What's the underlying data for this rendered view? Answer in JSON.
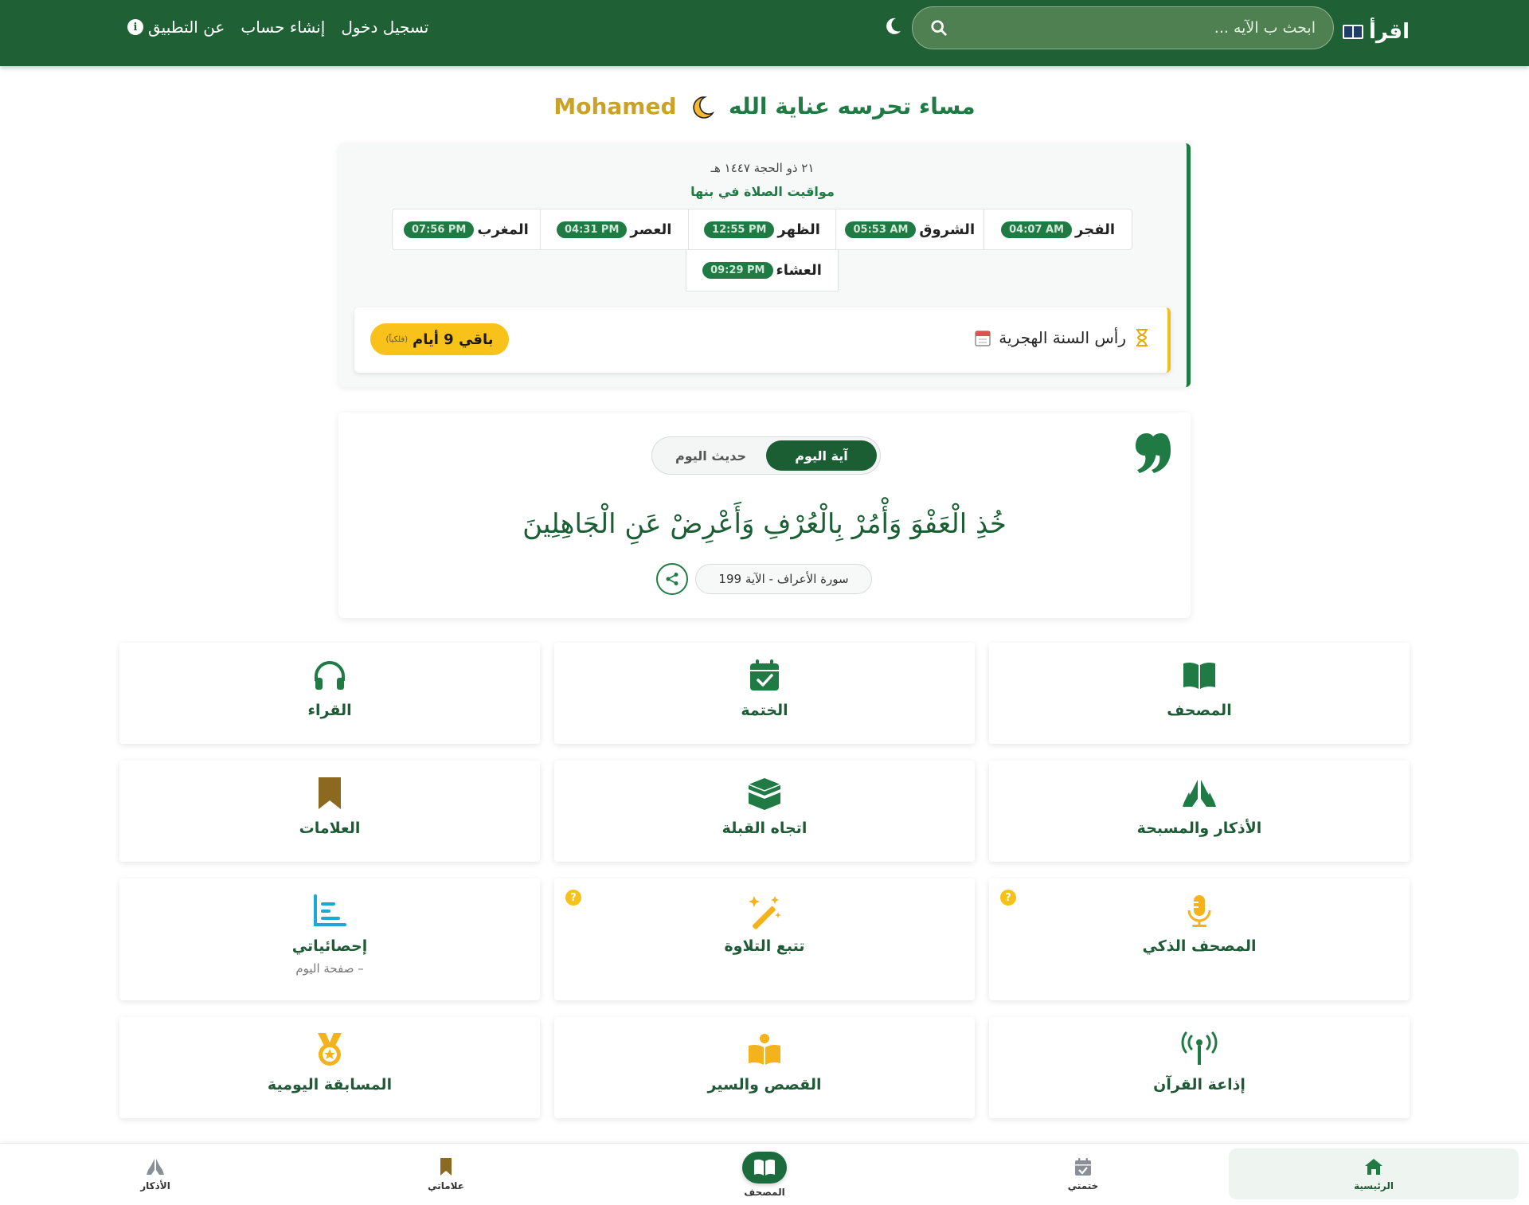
{
  "header": {
    "brand": "اقرأ",
    "search_placeholder": "ابحث ب الآيه ...",
    "nav": {
      "login": "تسجيل دخول",
      "register": "إنشاء حساب",
      "about": "عن التطبيق",
      "info_glyph": "i"
    }
  },
  "greeting": {
    "text": "مساء تحرسه عناية الله",
    "name": "Mohamed"
  },
  "prayer": {
    "hijri_date": "٢١ ذو الحجة ١٤٤٧ هـ",
    "city_label": "مواقيت الصلاة في بنها",
    "times": [
      {
        "name": "الفجر",
        "time": "04:07 AM"
      },
      {
        "name": "الشروق",
        "time": "05:53 AM"
      },
      {
        "name": "الظهر",
        "time": "12:55 PM"
      },
      {
        "name": "العصر",
        "time": "04:31 PM"
      },
      {
        "name": "المغرب",
        "time": "07:56 PM"
      },
      {
        "name": "العشاء",
        "time": "09:29 PM"
      }
    ],
    "countdown": {
      "title": "رأس السنة الهجرية",
      "remaining": "باقي 9 أيام",
      "note": "(فلكياً)"
    }
  },
  "verse": {
    "tab_verse": "آية اليوم",
    "tab_hadith": "حديث اليوم",
    "text": "خُذِ الْعَفْوَ وَأْمُرْ بِالْعُرْفِ وَأَعْرِضْ عَنِ الْجَاهِلِينَ",
    "reference": "سورة الأعراف - الآية 199"
  },
  "tiles": [
    {
      "label": "المصحف",
      "icon": "book-open-icon"
    },
    {
      "label": "الختمة",
      "icon": "calendar-check-icon"
    },
    {
      "label": "القراء",
      "icon": "headphones-icon"
    },
    {
      "label": "الأذكار والمسبحة",
      "icon": "praying-hands-icon"
    },
    {
      "label": "اتجاه القبلة",
      "icon": "kaaba-icon"
    },
    {
      "label": "العلامات",
      "icon": "bookmark-icon"
    },
    {
      "label": "المصحف الذكي",
      "icon": "microphone-icon",
      "badge": "?"
    },
    {
      "label": "تتبع التلاوة",
      "icon": "magic-wand-icon",
      "badge": "?"
    },
    {
      "label": "إحصائياتي",
      "icon": "chart-icon",
      "sub": "– صفحة اليوم"
    },
    {
      "label": "إذاعة القرآن",
      "icon": "radio-tower-icon"
    },
    {
      "label": "القصص والسير",
      "icon": "reader-icon"
    },
    {
      "label": "المسابقة اليومية",
      "icon": "medal-icon"
    }
  ],
  "bottom_nav": {
    "home": "الرئيسية",
    "khatma": "ختمتي",
    "mushaf": "المصحف",
    "bookmarks": "علاماتي",
    "azkar": "الأذكار"
  },
  "colors": {
    "primary": "#1f6134",
    "accent_green": "#1f7a44",
    "gold": "#c9a227",
    "yellow": "#f8c21a"
  }
}
